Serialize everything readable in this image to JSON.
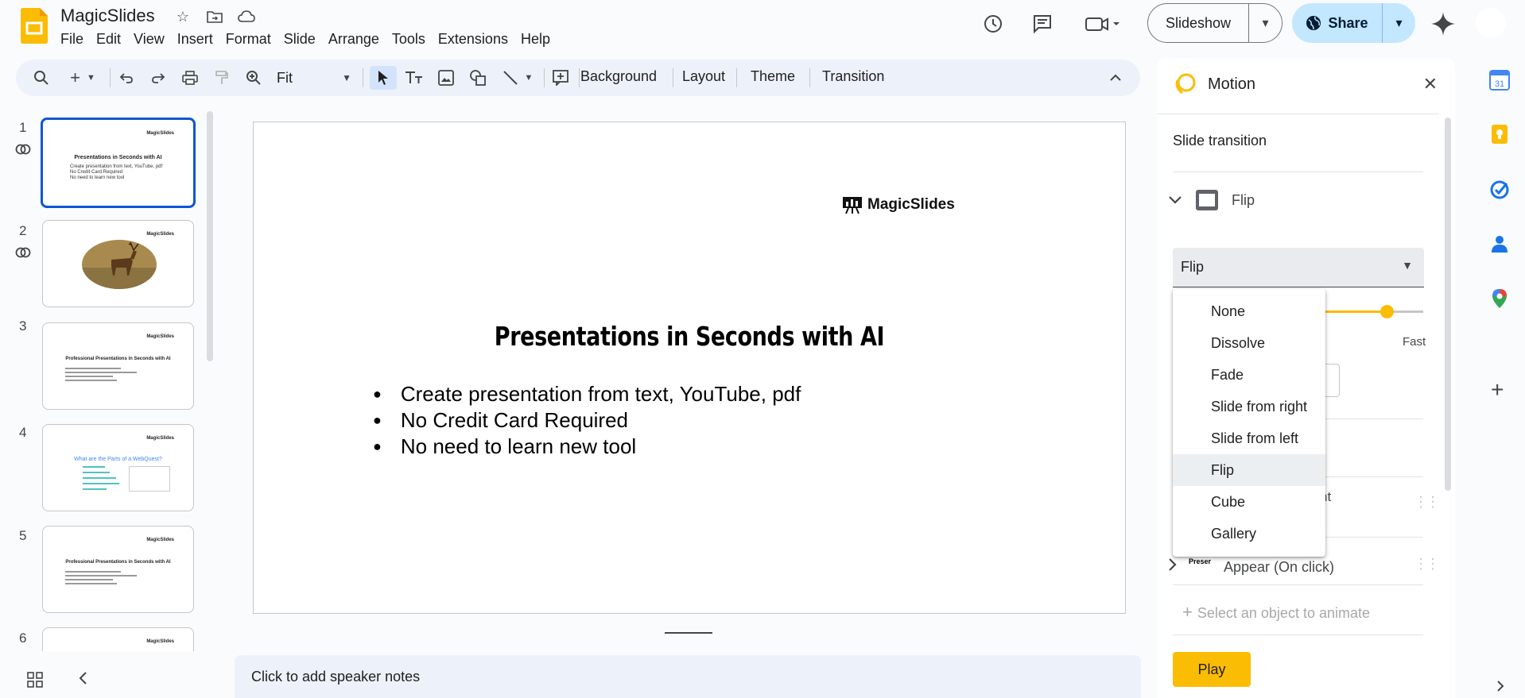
{
  "header": {
    "doc_title": "MagicSlides",
    "menu": [
      "File",
      "Edit",
      "View",
      "Insert",
      "Format",
      "Slide",
      "Arrange",
      "Tools",
      "Extensions",
      "Help"
    ],
    "slideshow_label": "Slideshow",
    "share_label": "Share"
  },
  "toolbar": {
    "zoom_label": "Fit",
    "background_label": "Background",
    "layout_label": "Layout",
    "theme_label": "Theme",
    "transition_label": "Transition"
  },
  "filmstrip": {
    "slides": [
      {
        "num": "1",
        "title": "Presentations in Seconds with AI",
        "lines": [
          "Create presentation from text, YouTube, pdf",
          "No Credit Card Required",
          "No need to learn new tool"
        ]
      },
      {
        "num": "2"
      },
      {
        "num": "3",
        "title": "Professional Presentations in Seconds with AI"
      },
      {
        "num": "4",
        "title": "What are the Parts of a WebQuest?"
      },
      {
        "num": "5",
        "title": "Professional Presentations in Seconds with AI"
      },
      {
        "num": "6"
      }
    ],
    "mini_logo": "MagicSlides"
  },
  "slide": {
    "brand": "MagicSlides",
    "title": "Presentations in Seconds with AI",
    "bullets": [
      "Create presentation from text, YouTube, pdf",
      "No Credit Card Required",
      "No need to learn new tool"
    ]
  },
  "notes": {
    "placeholder": "Click to add speaker notes"
  },
  "motion": {
    "title": "Motion",
    "section": "Slide transition",
    "transition_name": "Flip",
    "selected": "Flip",
    "fast_label": "Fast",
    "partial_text": "nt",
    "anim_label": "Appear  (On click)",
    "anim_thumb": "Preser",
    "select_obj": "Select an object to animate",
    "play_label": "Play",
    "options": [
      "None",
      "Dissolve",
      "Fade",
      "Slide from right",
      "Slide from left",
      "Flip",
      "Cube",
      "Gallery"
    ],
    "highlighted": "Flip"
  },
  "colors": {
    "accent": "#0b57d0",
    "share_bg": "#c2e7ff",
    "play_bg": "#fbbc04",
    "logo": "#fbbc04"
  }
}
